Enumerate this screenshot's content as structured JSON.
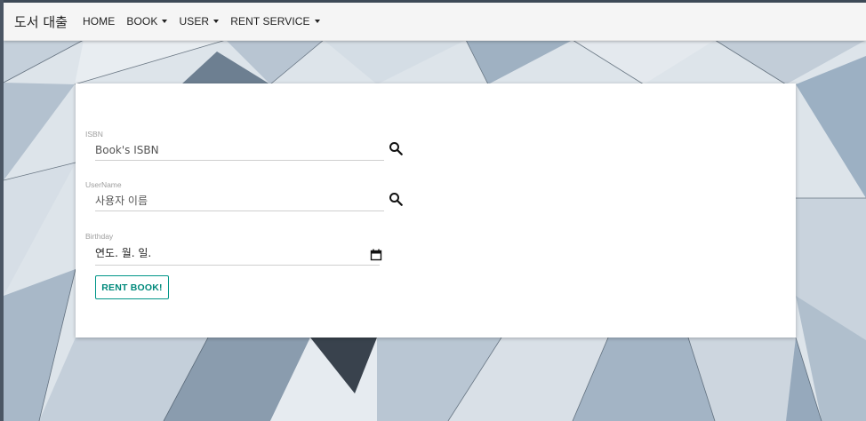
{
  "navbar": {
    "brand": "도서 대출",
    "items": [
      {
        "label": "HOME",
        "dropdown": false
      },
      {
        "label": "BOOK",
        "dropdown": true
      },
      {
        "label": "USER",
        "dropdown": true
      },
      {
        "label": "RENT SERVICE",
        "dropdown": true
      }
    ]
  },
  "form": {
    "isbn": {
      "label": "ISBN",
      "placeholder": "Book's ISBN",
      "icon": "search-icon"
    },
    "username": {
      "label": "UserName",
      "placeholder": "사용자 이름",
      "icon": "search-icon"
    },
    "birthday": {
      "label": "Birthday",
      "value": "연도. 월. 일.",
      "icon": "calendar-icon"
    },
    "submit_label": "RENT BOOK!"
  },
  "colors": {
    "accent": "#009688",
    "navbar_bg": "#f5f5f5",
    "card_bg": "#ffffff"
  }
}
